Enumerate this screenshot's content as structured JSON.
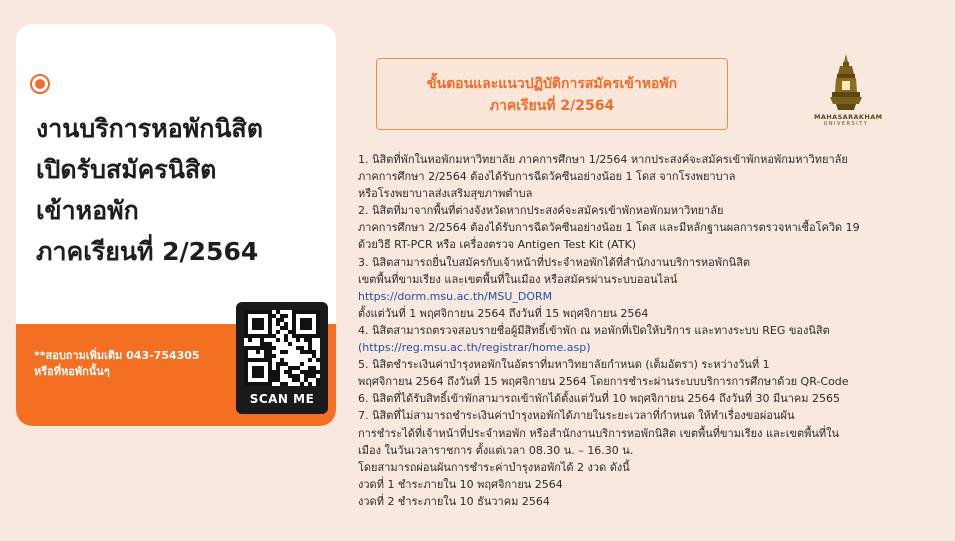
{
  "card": {
    "headline": [
      "งานบริการหอพักนิสิต",
      "เปิดรับสมัครนิสิต",
      "เข้าหอพัก",
      "ภาคเรียนที่ 2/2564"
    ],
    "contact": [
      "**สอบถามเพิ่มเติม 043-754305",
      "หรือที่หอพักนั้นๆ"
    ],
    "qr_label": "SCAN ME"
  },
  "title": {
    "line1": "ขั้นตอนและแนวปฏิบัติการสมัครเข้าหอพัก",
    "line2": "ภาคเรียนที่ 2/2564"
  },
  "logo": {
    "name": "MAHASARAKHAM",
    "sub": "UNIVERSITY"
  },
  "steps": [
    "1.  นิสิตที่พักในหอพักมหาวิทยาลัย ภาคการศึกษา 1/2564  หากประสงค์จะสมัครเข้าพักหอพักมหาวิทยาลัย",
    "ภาคการศึกษา 2/2564 ต้องได้รับการฉีดวัคซีนอย่างน้อย 1 โดส จากโรงพยาบาล",
    "หรือโรงพยาบาลส่งเสริมสุขภาพตำบล",
    "2.  นิสิตที่มาจากพื้นที่ต่างจังหวัดหากประสงค์จะสมัครเข้าพักหอพักมหาวิทยาลัย",
    "ภาคการศึกษา 2/2564 ต้องได้รับการฉีดวัคซีนอย่างน้อย 1 โดส และมีหลักฐานผลการตรวจหาเชื้อโควิด 19",
    "ด้วยวิธี RT-PCR หรือ เครื่องตรวจ Antigen Test Kit (ATK)",
    "3.  นิสิตสามารถยื่นใบสมัครกับเจ้าหน้าที่ประจำหอพักได้ที่สำนักงานบริการหอพักนิสิต",
    "เขตพื้นที่ขามเรียง และเขตพื้นที่ในเมือง หรือสมัครผ่านระบบออนไลน์",
    "https://dorm.msu.ac.th/MSU_DORM",
    "ตั้งแต่วันที่ 1 พฤศจิกายน 2564 ถึงวันที่ 15 พฤศจิกายน 2564",
    "4.  นิสิตสามารถตรวจสอบรายชื่อผู้มีสิทธิ์เข้าพัก ณ หอพักที่เปิดให้บริการ และทางระบบ REG ของนิสิต",
    "(https://reg.msu.ac.th/registrar/home.asp)",
    "5.  นิสิตชำระเงินค่าบำรุงหอพักในอัตราที่มหาวิทยาลัยกำหนด (เต็มอัตรา) ระหว่างวันที่  1",
    "พฤศจิกายน 2564  ถึงวันที่ 15 พฤศจิกายน 2564  โดยการชำระผ่านระบบบริการการศึกษาด้วย QR-Code",
    "6.  นิสิตที่ได้รับสิทธิ์เข้าพักสามารถเข้าพักได้ตั้งแต่วันที่ 10 พฤศจิกายน 2564 ถึงวันที่ 30 มีนาคม 2565",
    "7.  นิสิตที่ไม่สามารถชำระเงินค่าบำรุงหอพักได้ภายในระยะเวลาที่กำหนด ให้ทำเรื่องขอผ่อนผัน",
    "การชำระได้ที่เจ้าหน้าที่ประจำหอพัก หรือสำนักงานบริการหอพักนิสิต เขตพื้นที่ขามเรียง และเขตพื้นที่ใน",
    "เมือง ในวันเวลาราชการ ตั้งแต่เวลา 08.30 น. – 16.30 น.",
    "โดยสามารถผ่อนผันการชำระค่าบำรุงหอพักได้ 2 งวด ดังนี้",
    "งวดที่ 1  ชำระภายใน 10 พฤศจิกายน 2564",
    "งวดที่ 2  ชำระภายใน  10 ธันวาคม 2564"
  ],
  "colors": {
    "background": "#f9e8dd",
    "accent": "#f36f21",
    "link": "#1f4fa8"
  }
}
